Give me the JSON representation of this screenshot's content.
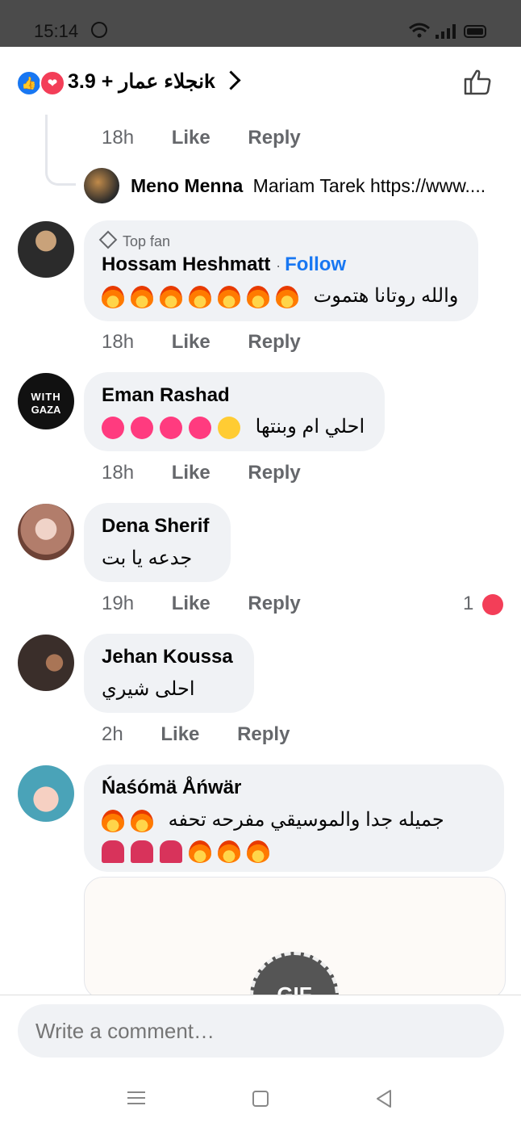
{
  "status_bar": {
    "time": "15:14"
  },
  "header": {
    "reactors_text": "نجلاء عمار + 3.9k",
    "like_color": "#1877f2",
    "love_color": "#f33e58"
  },
  "comments": [
    {
      "meta_time": "18h",
      "like": "Like",
      "reply": "Reply"
    },
    {
      "reply_author": "Meno Menna",
      "reply_text": "Mariam Tarek  https://www....",
      "author": "Hossam Heshmatt",
      "badge": "Top fan",
      "follow": "Follow",
      "text": "والله روتانا هتموت",
      "time": "18h",
      "like": "Like",
      "reply": "Reply"
    },
    {
      "author": "Eman Rashad",
      "text": "احلي ام وبنتها",
      "time": "18h",
      "like": "Like",
      "reply": "Reply"
    },
    {
      "author": "Dena Sherif",
      "text": "جدعه يا بت",
      "time": "19h",
      "like": "Like",
      "reply": "Reply",
      "reaction_count": "1"
    },
    {
      "author": "Jehan Koussa",
      "text": "احلى شيري",
      "time": "2h",
      "like": "Like",
      "reply": "Reply"
    },
    {
      "author": "Ńaśómä Åńwär",
      "text": "جميله جدا والموسيقي مفرحه  تحفه"
    }
  ],
  "gif_label": "GIF",
  "composer": {
    "placeholder": "Write a comment…"
  },
  "icons": {
    "like": "thumbs-up-icon",
    "back": "chevron-right-icon",
    "nav_menu": "menu-icon",
    "nav_home": "square-icon",
    "nav_back": "triangle-back-icon"
  }
}
